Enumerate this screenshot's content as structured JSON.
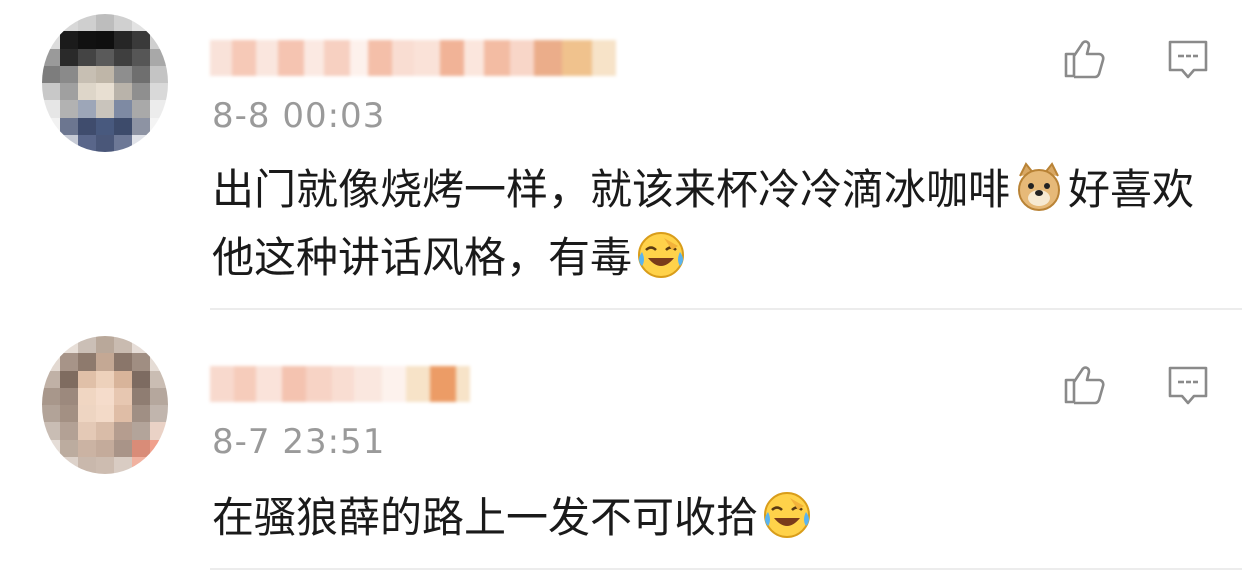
{
  "comments": [
    {
      "username": "",
      "time": "8-8 00:03",
      "text_before": "出门就像烧烤一样，就该来杯冷冷滴冰咖啡",
      "text_after": "好喜欢他这种讲话风格，有毒",
      "emojis": [
        "doge-emoji",
        "laugh-cry-emoji"
      ]
    },
    {
      "username": "",
      "time": "8-7 23:51",
      "text_before": "在骚狼薛的路上一发不可收拾",
      "emojis": [
        "laugh-cry-emoji"
      ]
    }
  ],
  "icons": {
    "like": "thumbs-up-icon",
    "reply": "comment-bubble-icon"
  },
  "colors": {
    "text": "#1a1a1a",
    "time": "#9a9a9a",
    "icon": "#8a8a8a",
    "divider": "#ececec"
  }
}
